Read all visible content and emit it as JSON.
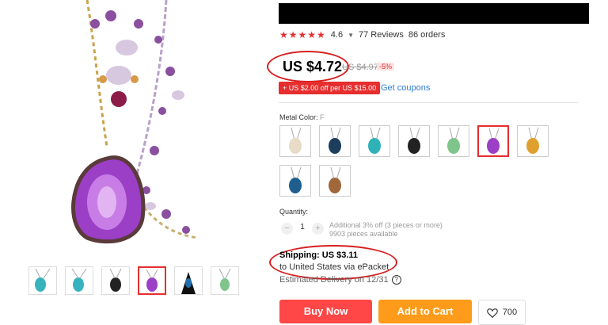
{
  "product": {
    "rating": "4.6",
    "reviews_count": "77 Reviews",
    "orders": "86 orders",
    "stars": "★★★★★"
  },
  "price": {
    "current": "US $4.72",
    "original": "US $4.97",
    "discount": "-5%"
  },
  "coupon": {
    "tag": "+ US $2.00 off per US $15.00",
    "link": "Get coupons"
  },
  "variants": {
    "label": "Metal Color:",
    "selected": "F"
  },
  "quantity": {
    "label": "Quantity:",
    "minus": "−",
    "value": "1",
    "plus": "+",
    "note_line1": "Additional 3% off (3 pieces or more)",
    "note_line2": "9903 pieces available"
  },
  "shipping": {
    "main": "Shipping: US $3.11",
    "sub": "to United States via ePacket",
    "estimate": "Estimated Delivery on 12/31",
    "help": "?"
  },
  "actions": {
    "buy_now": "Buy Now",
    "add_to_cart": "Add to Cart",
    "wishlist_count": "700"
  },
  "colors": {
    "accent": "#e62e2e",
    "buy": "#ff4747",
    "cart": "#ff9b1a",
    "link": "#2e7ccf"
  }
}
